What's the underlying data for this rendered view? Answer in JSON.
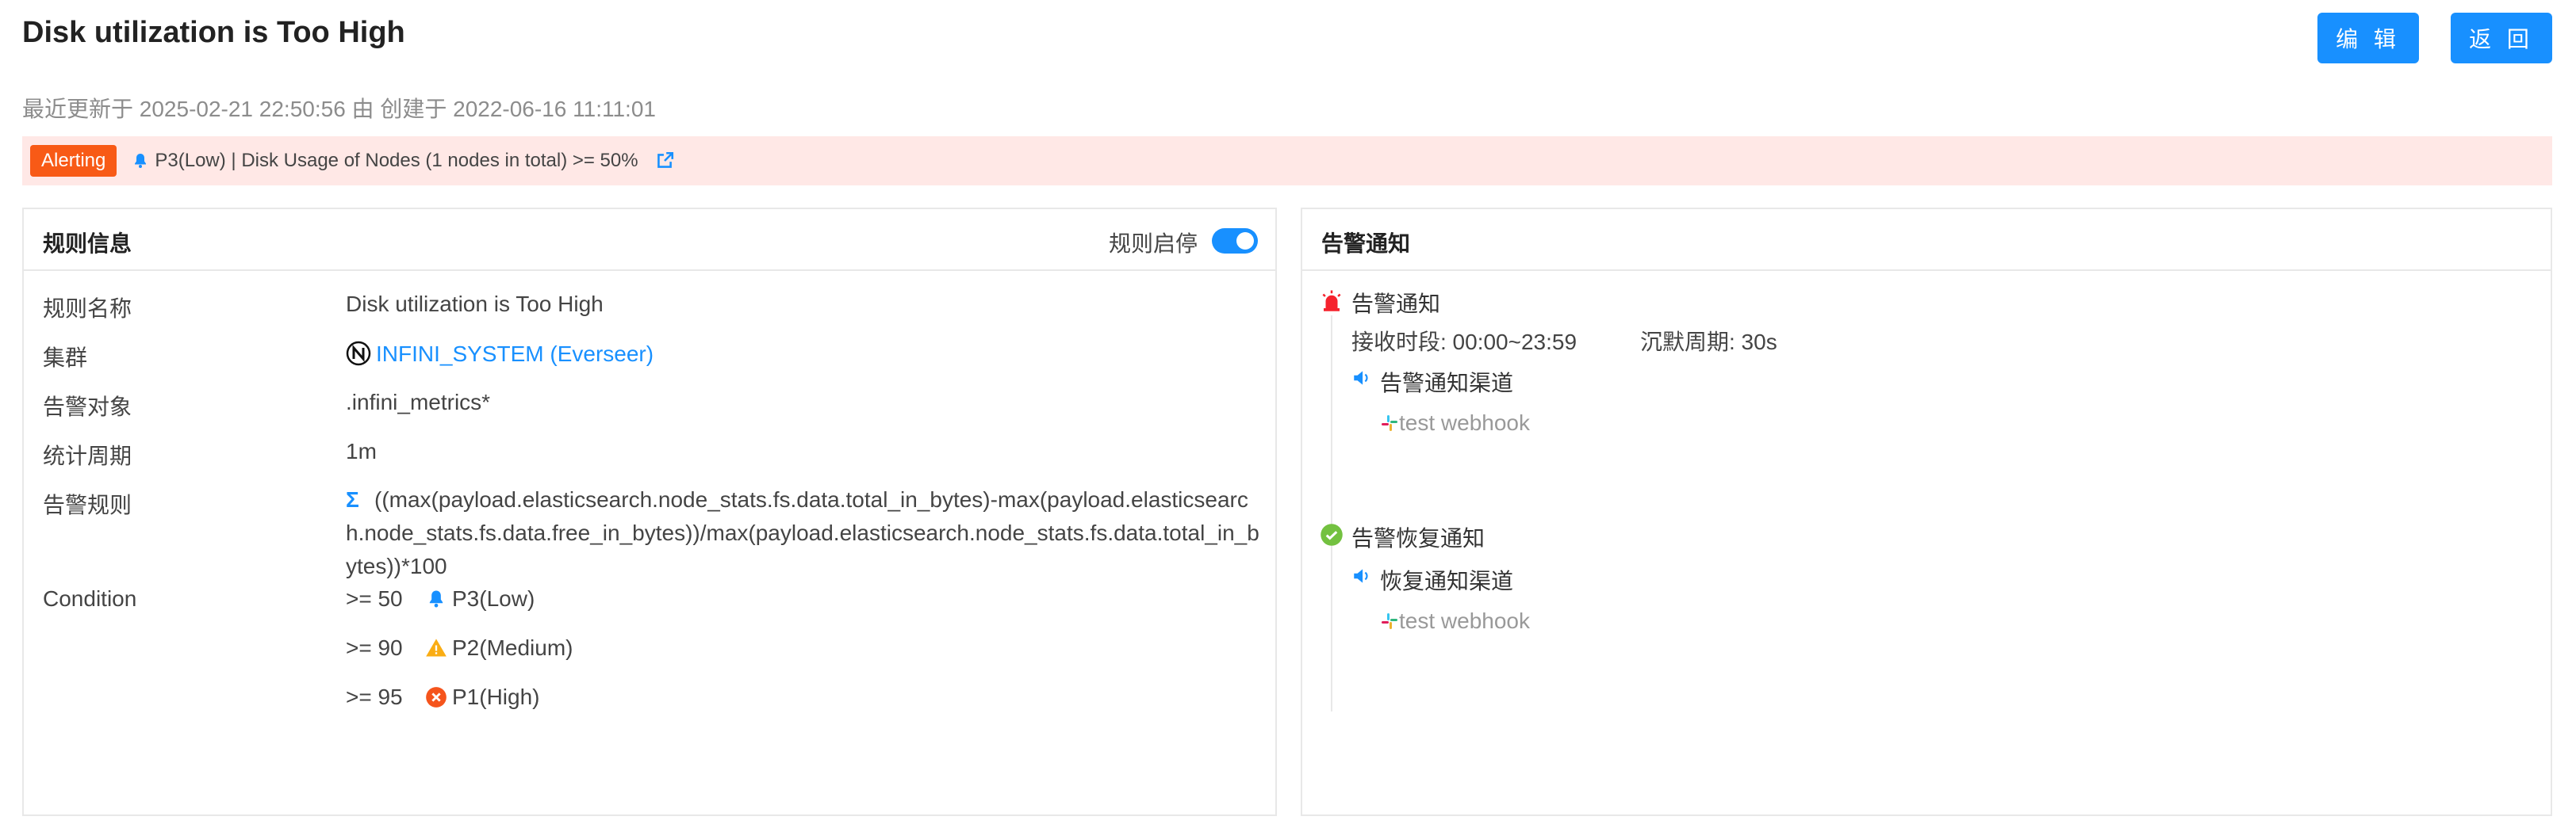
{
  "header": {
    "title": "Disk utilization is Too High",
    "edit_label": "编 辑",
    "back_label": "返 回",
    "meta": "最近更新于 2025-02-21 22:50:56 由 创建于 2022-06-16 11:11:01"
  },
  "alert": {
    "status": "Alerting",
    "message": "P3(Low) | Disk Usage of Nodes (1 nodes in total) >= 50%"
  },
  "rule_info": {
    "title": "规则信息",
    "toggle_label": "规则启停",
    "toggle_on": true,
    "rows": [
      {
        "label": "规则名称",
        "value": "Disk utilization is Too High"
      },
      {
        "label": "集群",
        "value": "INFINI_SYSTEM (Everseer)"
      },
      {
        "label": "告警对象",
        "value": ".infini_metrics*"
      },
      {
        "label": "统计周期",
        "value": "1m"
      },
      {
        "label": "告警规则",
        "value": "((max(payload.elasticsearch.node_stats.fs.data.total_in_bytes)-max(payload.elasticsearch.node_stats.fs.data.free_in_bytes))/max(payload.elasticsearch.node_stats.fs.data.total_in_bytes))*100"
      },
      {
        "label": "Condition",
        "value": ""
      }
    ],
    "conditions": [
      {
        "op": ">= 50",
        "level": "P3(Low)",
        "icon": "bell-icon",
        "color": "#1890ff"
      },
      {
        "op": ">= 90",
        "level": "P2(Medium)",
        "icon": "warning-icon",
        "color": "#faad14"
      },
      {
        "op": ">= 95",
        "level": "P1(High)",
        "icon": "error-icon",
        "color": "#f5541c"
      }
    ]
  },
  "notification": {
    "title": "告警通知",
    "alert_section": {
      "label": "告警通知",
      "receive_period": "接收时段: 00:00~23:59",
      "silence_period": "沉默周期: 30s",
      "channel_label": "告警通知渠道",
      "channel_name": "test webhook"
    },
    "recovery_section": {
      "label": "告警恢复通知",
      "channel_label": "恢复通知渠道",
      "channel_name": "test webhook"
    }
  },
  "colors": {
    "primary": "#1890ff",
    "alert_bg": "#ffe8e6",
    "alert_tag": "#f85a16",
    "success": "#73c140",
    "danger": "#f5222d"
  }
}
